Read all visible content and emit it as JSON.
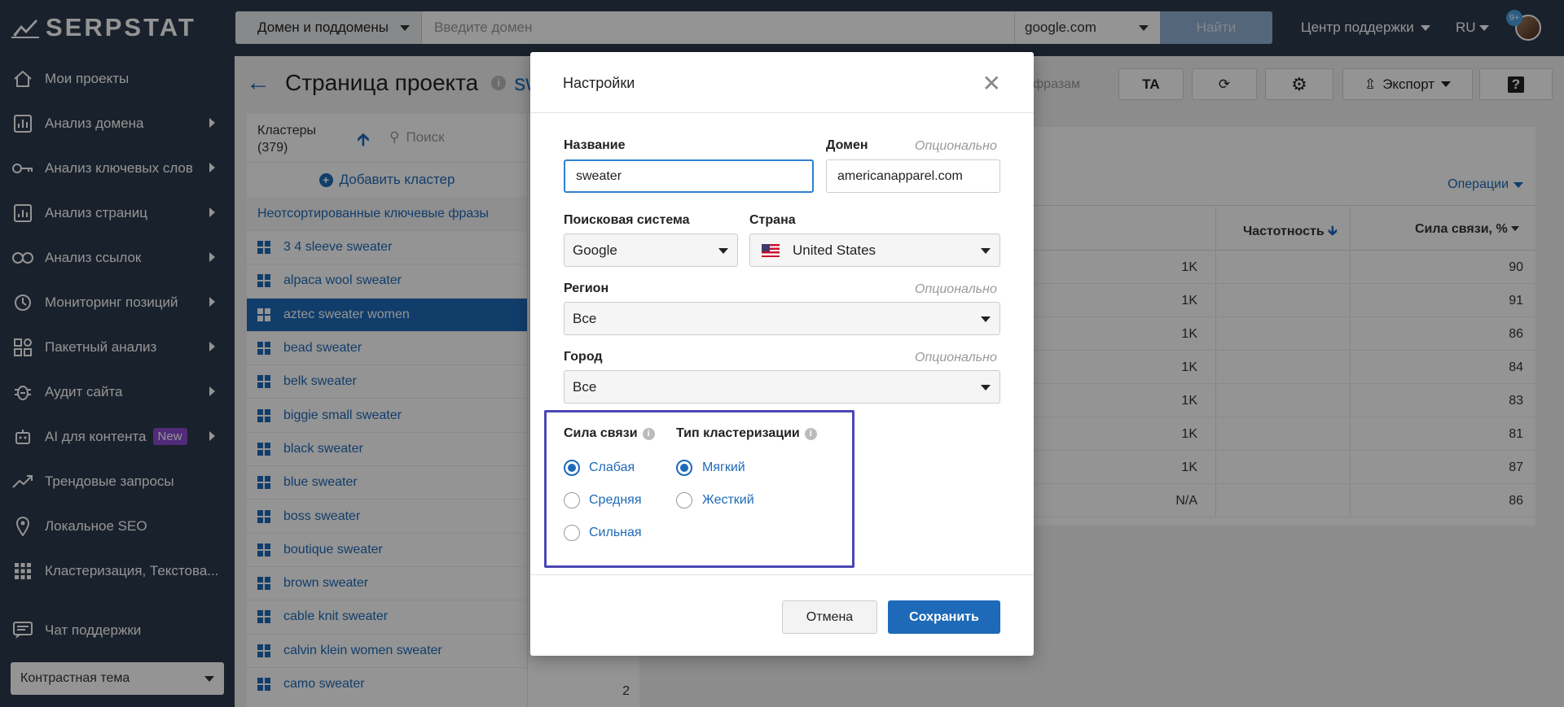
{
  "brand": {
    "name": "SERPSTAT"
  },
  "sidebar": {
    "items": [
      {
        "label": "Мои проекты",
        "icon": "home-icon",
        "arrow": false
      },
      {
        "label": "Анализ домена",
        "icon": "bar-chart-icon",
        "arrow": true
      },
      {
        "label": "Анализ ключевых слов",
        "icon": "key-icon",
        "arrow": true
      },
      {
        "label": "Анализ страниц",
        "icon": "page-chart-icon",
        "arrow": true
      },
      {
        "label": "Анализ ссылок",
        "icon": "link-icon",
        "arrow": true
      },
      {
        "label": "Мониторинг позиций",
        "icon": "clock-icon",
        "arrow": true
      },
      {
        "label": "Пакетный анализ",
        "icon": "batch-icon",
        "arrow": true
      },
      {
        "label": "Аудит сайта",
        "icon": "bug-icon",
        "arrow": true
      },
      {
        "label": "AI для контента",
        "icon": "robot-icon",
        "arrow": true,
        "badge": "New"
      },
      {
        "label": "Трендовые запросы",
        "icon": "trend-icon",
        "arrow": false
      },
      {
        "label": "Локальное SEO",
        "icon": "pin-icon",
        "arrow": false
      },
      {
        "label": "Кластеризация, Текстова...",
        "icon": "dots-grid-icon",
        "arrow": false
      }
    ],
    "chat": "Чат поддержки",
    "theme": "Контрастная тема"
  },
  "topbar": {
    "domain_type": "Домен и поддомены",
    "domain_placeholder": "Введите домен",
    "engine": "google.com",
    "find": "Найти",
    "support": "Центр поддержки",
    "lang": "RU",
    "notifications": "9+"
  },
  "page": {
    "title": "Страница проекта",
    "title_suffix": "sw",
    "faded_text": "фразам",
    "buttons": {
      "ta": "TA",
      "export": "Экспорт"
    }
  },
  "clusters": {
    "title": "Кластеры",
    "count": "(379)",
    "search_placeholder": "Поиск",
    "add": "Добавить кластер",
    "unsorted": "Неотсортированные ключевые фразы",
    "items": [
      "3 4 sleeve sweater",
      "alpaca wool sweater",
      "aztec sweater women",
      "bead sweater",
      "belk sweater",
      "biggie small sweater",
      "black sweater",
      "blue sweater",
      "boss sweater",
      "boutique sweater",
      "brown sweater",
      "cable knit sweater",
      "calvin klein women sweater",
      "camo sweater"
    ],
    "active_index": 2,
    "last_count": "2"
  },
  "table": {
    "operations": "Операции",
    "col_freq": "Частотность",
    "col_strength": "Сила связи, %",
    "rows": [
      {
        "freq": "1K",
        "strength": "90"
      },
      {
        "freq": "1K",
        "strength": "91"
      },
      {
        "freq": "1K",
        "strength": "86"
      },
      {
        "freq": "1K",
        "strength": "84"
      },
      {
        "freq": "1K",
        "strength": "83"
      },
      {
        "freq": "1K",
        "strength": "81"
      },
      {
        "freq": "1K",
        "strength": "87"
      },
      {
        "freq": "N/A",
        "strength": "86"
      }
    ]
  },
  "modal": {
    "title": "Настройки",
    "name_label": "Название",
    "name_value": "sweater",
    "domain_label": "Домен",
    "optional": "Опционально",
    "domain_value": "americanapparel.com",
    "engine_label": "Поисковая система",
    "engine_value": "Google",
    "country_label": "Страна",
    "country_value": "United States",
    "region_label": "Регион",
    "region_value": "Все",
    "city_label": "Город",
    "city_value": "Все",
    "strength_label": "Сила связи",
    "strength_options": [
      "Слабая",
      "Средняя",
      "Сильная"
    ],
    "strength_selected": "Слабая",
    "type_label": "Тип кластеризации",
    "type_options": [
      "Мягкий",
      "Жесткий"
    ],
    "type_selected": "Мягкий",
    "cancel": "Отмена",
    "save": "Сохранить"
  }
}
